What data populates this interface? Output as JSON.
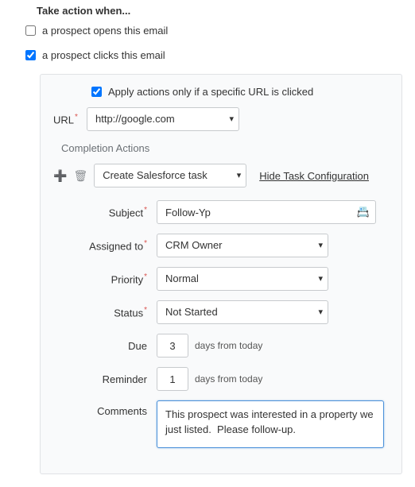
{
  "title": "Take action when...",
  "triggers": {
    "opens": {
      "label": "a prospect opens this email",
      "checked": false
    },
    "clicks": {
      "label": "a prospect clicks this email",
      "checked": true
    }
  },
  "panel": {
    "apply_specific": {
      "label": "Apply actions only if a specific URL is clicked",
      "checked": true
    },
    "url": {
      "label": "URL",
      "value": "http://google.com"
    },
    "subsection": "Completion Actions",
    "action_select": "Create Salesforce task",
    "toggle_link": "Hide Task Configuration",
    "fields": {
      "subject": {
        "label": "Subject",
        "value": "Follow-Yp"
      },
      "assigned_to": {
        "label": "Assigned to",
        "value": "CRM Owner"
      },
      "priority": {
        "label": "Priority",
        "value": "Normal"
      },
      "status": {
        "label": "Status",
        "value": "Not Started"
      },
      "due": {
        "label": "Due",
        "value": "3",
        "suffix": "days from today"
      },
      "reminder": {
        "label": "Reminder",
        "value": "1",
        "suffix": "days from today"
      },
      "comments": {
        "label": "Comments",
        "value": "This prospect was interested in a property we just listed.  Please follow-up."
      }
    }
  }
}
